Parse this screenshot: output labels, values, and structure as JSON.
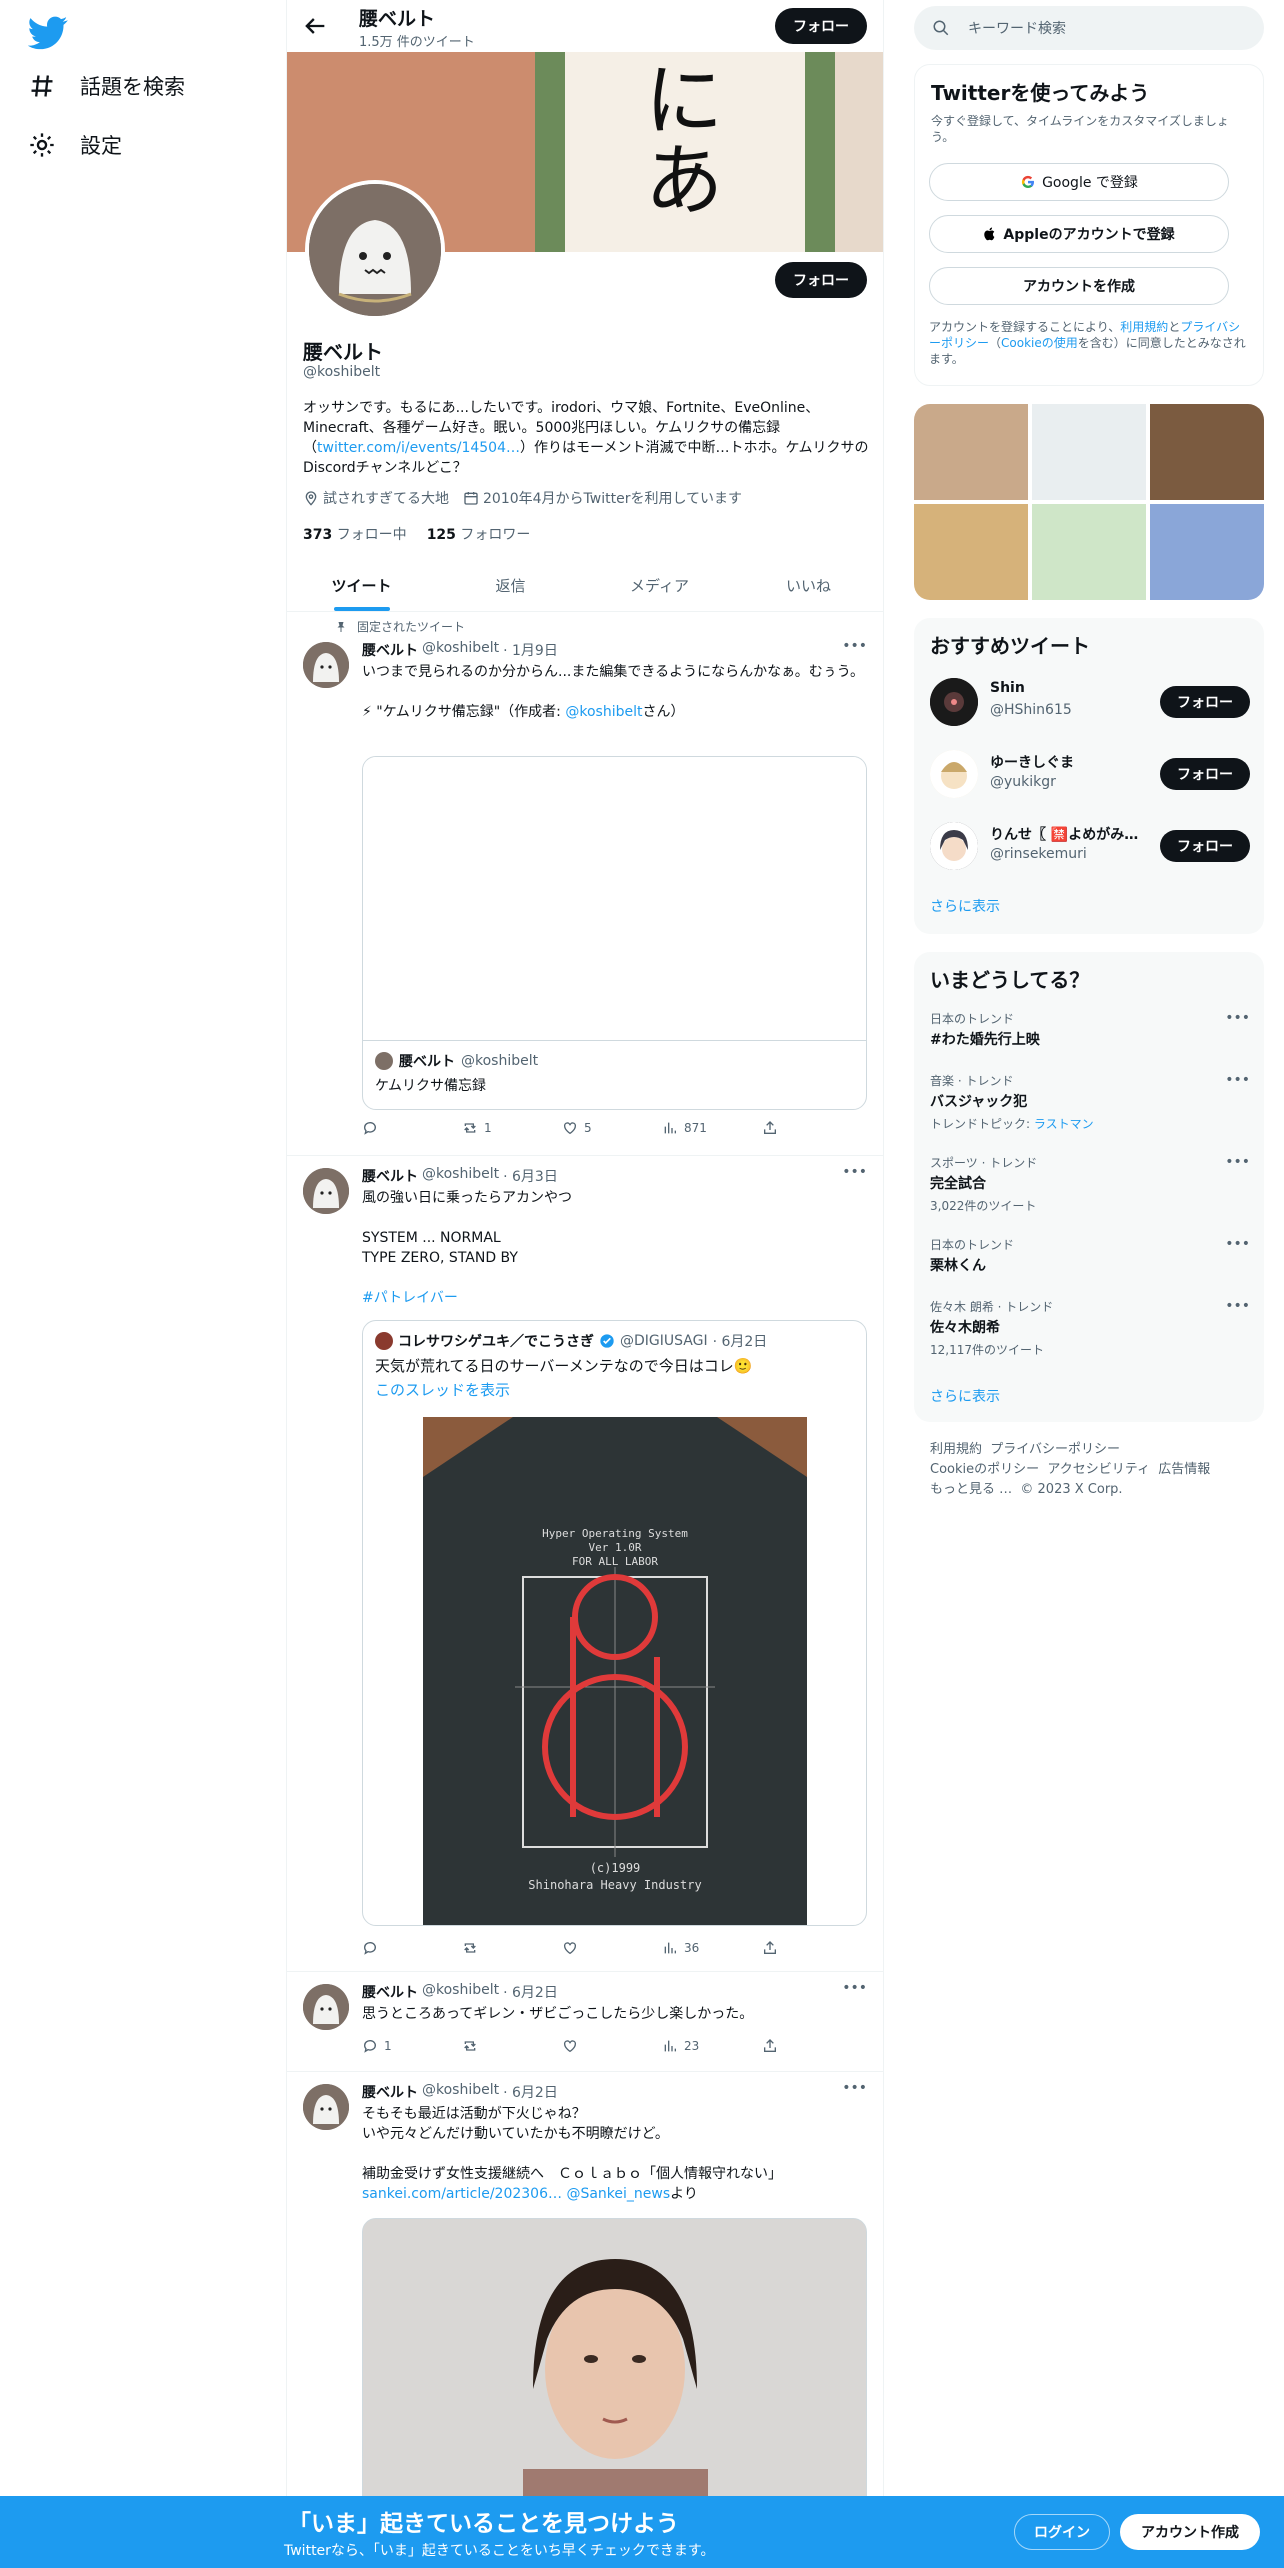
{
  "nav": {
    "items": [
      {
        "label": "話題を検索",
        "icon": "hashtag-icon"
      },
      {
        "label": "設定",
        "icon": "gear-icon"
      }
    ]
  },
  "header": {
    "name": "腰ベルト",
    "tweet_count": "1.5万 件のツイート",
    "follow": "フォロー"
  },
  "banner": {
    "char": "にあ"
  },
  "profile": {
    "name": "腰ベルト",
    "handle": "@koshibelt",
    "follow": "フォロー",
    "bio_1": "オッサンです。もるにあ...したいです。irodori、ウマ娘、Fortnite、EveOnline、Minecraft、各種ゲーム好き。眠い。5000兆円ほしい。ケムリクサの備忘録（",
    "bio_link": "twitter.com/i/events/14504…",
    "bio_2": "）作りはモーメント消滅で中断…トホホ。ケムリクサのDiscordチャンネルどこ？",
    "location": "試されすぎてる大地",
    "joined": "2010年4月からTwitterを利用しています",
    "following_count": "373",
    "following_label": "フォロー中",
    "followers_count": "125",
    "followers_label": "フォロワー"
  },
  "tabs": [
    "ツイート",
    "返信",
    "メディア",
    "いいね"
  ],
  "tweets": [
    {
      "pinned": "固定されたツイート",
      "name": "腰ベルト",
      "handle": "@koshibelt",
      "date": "· 1月9日",
      "text_1": "いつまで見られるのか分からん...また編集できるようにならんかなぁ。むぅう。",
      "text_2_pre": "⚡ \"ケムリクサ備忘録\"（作成者: ",
      "text_2_link": "@koshibelt",
      "text_2_post": "さん）",
      "card_name": "腰ベルト",
      "card_handle": "@koshibelt",
      "card_title": "ケムリクサ備忘録",
      "reply": "",
      "retweet": "1",
      "like": "5",
      "views": "871"
    },
    {
      "name": "腰ベルト",
      "handle": "@koshibelt",
      "date": "· 6月3日",
      "text_1": "風の強い日に乗ったらアカンやつ",
      "text_2": "SYSTEM ... NORMAL",
      "text_3": "TYPE ZERO, STAND BY",
      "hashtag": "#パトレイバー",
      "quote_name": "コレサワシゲユキ／でこうさぎ",
      "quote_handle": "@DIGIUSAGI",
      "quote_date": "· 6月2日",
      "quote_text": "天気が荒れてる日のサーバーメンテなので今日はコレ🙂",
      "quote_thread": "このスレッドを表示",
      "shirt_1": "Hyper Operating System",
      "shirt_2": "Ver 1.0R",
      "shirt_3": "FOR ALL LABOR",
      "shirt_4": "(c)1999",
      "shirt_5": "Shinohara Heavy Industry",
      "reply": "",
      "retweet": "",
      "like": "",
      "views": "36"
    },
    {
      "name": "腰ベルト",
      "handle": "@koshibelt",
      "date": "· 6月2日",
      "text_1": "思うところあってギレン・ザビごっこしたら少し楽しかった。",
      "reply": "1",
      "retweet": "",
      "like": "",
      "views": "23"
    },
    {
      "name": "腰ベルト",
      "handle": "@koshibelt",
      "date": "· 6月2日",
      "text_1": "そもそも最近は活動が下火じゃね？",
      "text_2": "いや元々どんだけ動いていたかも不明瞭だけど。",
      "text_3": "補助金受けず女性支援継続へ　Ｃｏｌａｂｏ「個人情報守れない」",
      "link": "sankei.com/article/202306…",
      "mention": "@Sankei_news",
      "tail": "より"
    }
  ],
  "right": {
    "search_placeholder": "キーワード検索",
    "signup": {
      "title": "Twitterを使ってみよう",
      "subtitle": "今すぐ登録して、タイムラインをカスタマイズしましょう。",
      "google": "Google で登録",
      "apple": "Appleのアカウントで登録",
      "create": "アカウントを作成",
      "terms_1": "アカウントを登録することにより、",
      "terms_link1": "利用規約",
      "terms_2": "と",
      "terms_link2": "プライバシーポリシー",
      "terms_3": "（",
      "terms_link3": "Cookieの使用",
      "terms_4": "を含む）に同意したとみなされます。"
    },
    "recommend": {
      "title": "おすすめツイート",
      "users": [
        {
          "name": "Shin",
          "handle": "@HShin615"
        },
        {
          "name": "ゆーきしぐま",
          "handle": "@yukikgr"
        },
        {
          "name": "りんせ〖 🈲よめがみ…",
          "handle": "@rinsekemuri"
        }
      ],
      "follow": "フォロー",
      "more": "さらに表示"
    },
    "trends": {
      "title": "いまどうしてる？",
      "items": [
        {
          "context": "日本のトレンド",
          "topic": "#わた婚先行上映",
          "sub": ""
        },
        {
          "context": "音楽 · トレンド",
          "topic": "バスジャック犯",
          "sub": "トレンドトピック: ",
          "sub_link": "ラストマン"
        },
        {
          "context": "スポーツ · トレンド",
          "topic": "完全試合",
          "sub": "3,022件のツイート"
        },
        {
          "context": "日本のトレンド",
          "topic": "栗林くん",
          "sub": ""
        },
        {
          "context": "佐々木 朗希 · トレンド",
          "topic": "佐々木朗希",
          "sub": "12,117件のツイート"
        }
      ],
      "more": "さらに表示"
    },
    "footer": {
      "l1": "利用規約",
      "l2": "プライバシーポリシー",
      "l3": "Cookieのポリシー",
      "l4": "アクセシビリティ",
      "l5": "広告情報",
      "l6": "もっと見る …",
      "copy": "© 2023 X Corp."
    }
  },
  "bottom": {
    "title": "「いま」起きていることを見つけよう",
    "subtitle": "Twitterなら、「いま」起きていることをいち早くチェックできます。",
    "login": "ログイン",
    "signup": "アカウント作成"
  },
  "colors": {
    "accent": "#1d9bf0",
    "text": "#0f1419",
    "muted": "#536471"
  }
}
